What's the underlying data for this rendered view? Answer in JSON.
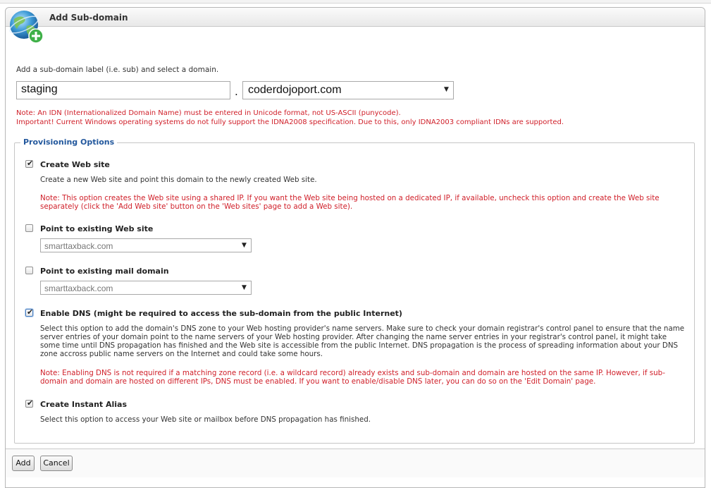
{
  "panel": {
    "title": "Add Sub-domain",
    "icon": "globe-add-icon"
  },
  "form": {
    "intro": "Add a sub-domain label (i.e. sub) and select a domain.",
    "subdomain_value": "staging",
    "separator": ".",
    "domain_selected": "coderdojoport.com",
    "idn_note_1": "Note: An IDN (Internationalized Domain Name) must be entered in Unicode format, not US-ASCII (punycode).",
    "idn_note_2": "Important! Current Windows operating systems do not fully support the IDNA2008 specification. Due to this, only IDNA2003 compliant IDNs are supported."
  },
  "provisioning": {
    "legend": "Provisioning Options",
    "create_web_site": {
      "checked": true,
      "label": "Create Web site",
      "desc": "Create a new Web site and point this domain to the newly created Web site.",
      "note": "Note: This option creates the Web site using a shared IP. If you want the Web site being hosted on a dedicated IP, if available, uncheck this option and create the Web site separately (click the 'Add Web site' button on the 'Web sites' page to add a Web site)."
    },
    "point_web_site": {
      "checked": false,
      "label": "Point to existing Web site",
      "selected": "smarttaxback.com"
    },
    "point_mail_domain": {
      "checked": false,
      "label": "Point to existing mail domain",
      "selected": "smarttaxback.com"
    },
    "enable_dns": {
      "checked": true,
      "label": "Enable DNS (might be required to access the sub-domain from the public Internet)",
      "desc": "Select this option to add the domain's DNS zone to your Web hosting provider's name servers. Make sure to check your domain registrar's control panel to ensure that the name server entries of your domain point to the name servers of your Web hosting provider. After changing the name server entries in your registrar's control panel, it might take some time until DNS propagation has finished and the Web site is accessible from the public Internet. DNS propagation is the process of spreading information about your DNS zone accross public name servers on the Internet and could take some hours.",
      "note": "Note: Enabling DNS is not required if a matching zone record (i.e. a wildcard record) already exists and sub-domain and domain are hosted on the same IP. However, if sub-domain and domain are hosted on different IPs, DNS must be enabled. If you want to enable/disable DNS later, you can do so on the 'Edit Domain' page."
    },
    "instant_alias": {
      "checked": true,
      "label": "Create Instant Alias",
      "desc": "Select this option to access your Web site or mailbox before DNS propagation has finished."
    }
  },
  "buttons": {
    "add": "Add",
    "cancel": "Cancel"
  },
  "glyphs": {
    "check": "✔",
    "dropdown": "▼"
  }
}
